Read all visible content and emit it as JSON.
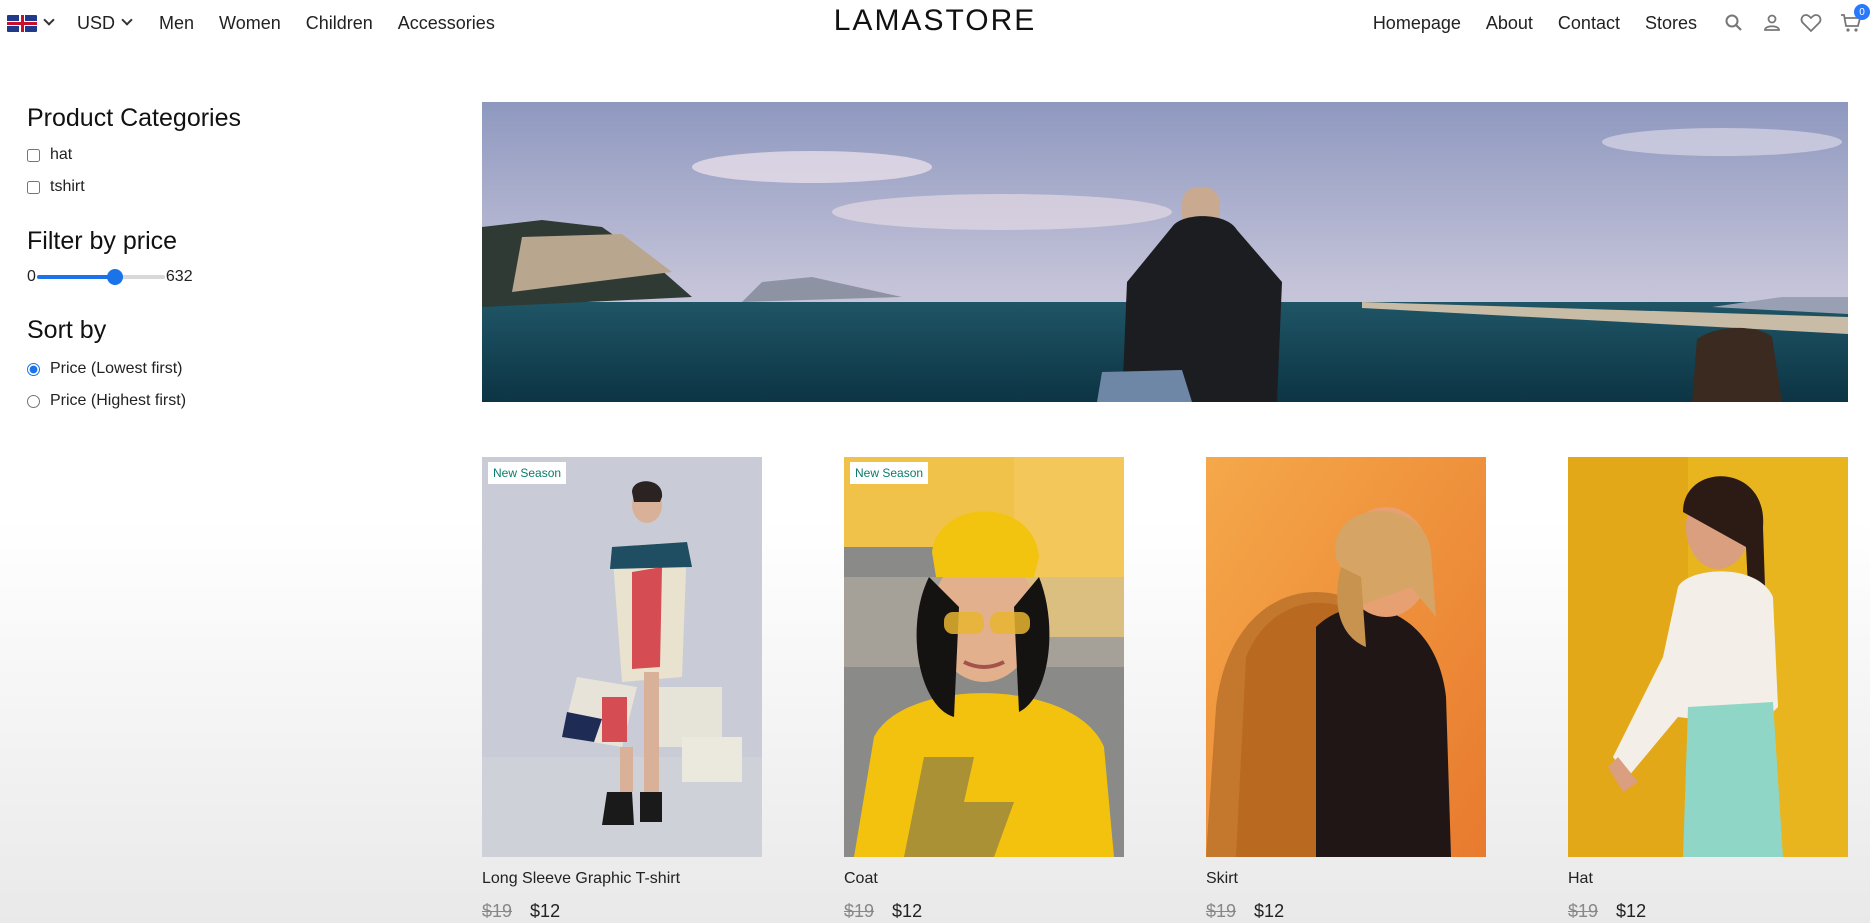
{
  "navbar": {
    "language_flag": "uk-flag-icon",
    "currency": "USD",
    "left_links": [
      "Men",
      "Women",
      "Children",
      "Accessories"
    ],
    "logo": "LAMASTORE",
    "right_links": [
      "Homepage",
      "About",
      "Contact",
      "Stores"
    ],
    "icons": [
      "search-icon",
      "person-icon",
      "heart-icon",
      "cart-icon"
    ],
    "cart_count": "0"
  },
  "sidebar": {
    "categories_title": "Product Categories",
    "categories": [
      "hat",
      "tshirt"
    ],
    "price_title": "Filter by price",
    "price_min": "0",
    "price_max": "632",
    "price_slider_fraction": 0.61,
    "sort_title": "Sort by",
    "sort_options": [
      "Price (Lowest first)",
      "Price (Highest first)"
    ],
    "sort_selected": 0
  },
  "products": [
    {
      "title": "Long Sleeve Graphic T-shirt",
      "old_price": "$19",
      "price": "$12",
      "badge": "New Season"
    },
    {
      "title": "Coat",
      "old_price": "$19",
      "price": "$12",
      "badge": "New Season"
    },
    {
      "title": "Skirt",
      "old_price": "$19",
      "price": "$12",
      "badge": ""
    },
    {
      "title": "Hat",
      "old_price": "$19",
      "price": "$12",
      "badge": ""
    }
  ],
  "colors": {
    "accent": "#1a73e8",
    "badge_text": "#0b7c6b",
    "cart_badge": "#2879fe"
  }
}
